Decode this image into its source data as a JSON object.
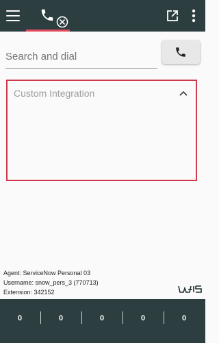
{
  "header": {
    "menu_icon": "menu-icon",
    "phone_icon": "phone-icon",
    "phone_status_icon": "circle-x-icon",
    "popout_icon": "external-link-icon",
    "more_icon": "vertical-dots-icon",
    "background_color": "#2d3e40",
    "accent_color": "#e04a5c"
  },
  "search": {
    "placeholder": "Search and dial",
    "value": "",
    "dial_icon": "phone-icon"
  },
  "integration": {
    "title": "Custom Integration",
    "collapse_icon": "chevron-up-icon",
    "border_color": "#d0384c"
  },
  "agent_info": {
    "agent": "Agent: ServiceNow Personal 03",
    "username": "Username: snow_pers_3 (770713)",
    "extension": "Extension: 342152"
  },
  "brand_logo_icon": "bcs-logo-icon",
  "footer": {
    "counters": [
      "0",
      "0",
      "0",
      "0",
      "0"
    ]
  }
}
